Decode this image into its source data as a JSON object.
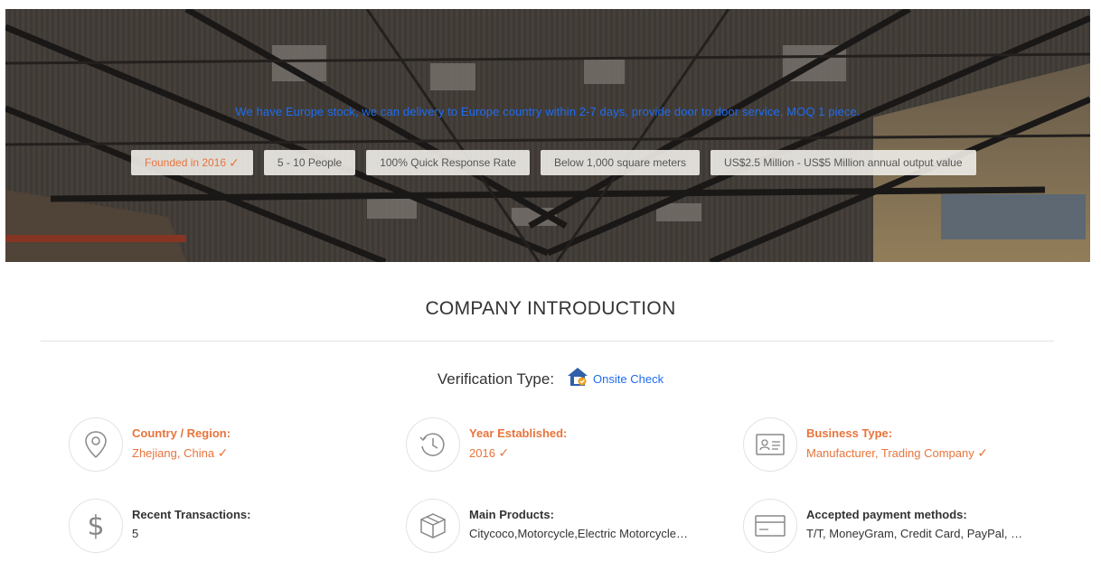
{
  "hero": {
    "tagline": "We have Europe stock, we can delivery to Europe country within 2-7 days, provide door to door service, MOQ 1 piece.",
    "badges": [
      {
        "label": "Founded in 2016",
        "verified": true
      },
      {
        "label": "5 - 10 People",
        "verified": false
      },
      {
        "label": "100% Quick Response Rate",
        "verified": false
      },
      {
        "label": "Below 1,000 square meters",
        "verified": false
      },
      {
        "label": "US$2.5 Million - US$5 Million annual output value",
        "verified": false
      }
    ]
  },
  "intro": {
    "title": "COMPANY INTRODUCTION",
    "verification_label": "Verification Type:",
    "verification_value": "Onsite Check"
  },
  "facts": [
    {
      "title": "Country / Region:",
      "value": "Zhejiang, China",
      "icon": "location-pin-icon",
      "verified": true
    },
    {
      "title": "Year Established:",
      "value": "2016",
      "icon": "history-clock-icon",
      "verified": true
    },
    {
      "title": "Business Type:",
      "value": "Manufacturer, Trading Company",
      "icon": "id-card-icon",
      "verified": true
    },
    {
      "title": "Recent Transactions:",
      "value": "5",
      "icon": "dollar-icon",
      "verified": false
    },
    {
      "title": "Main Products:",
      "value": "Citycoco,Motorcycle,Electric Motorcycle,Electric Scooter",
      "icon": "package-box-icon",
      "verified": false
    },
    {
      "title": "Accepted payment methods:",
      "value": "T/T, MoneyGram, Credit Card, PayPal, Western Union, Cash",
      "icon": "credit-card-icon",
      "verified": false
    }
  ],
  "colors": {
    "accent": "#e8743b",
    "link": "#1e6cf0",
    "text": "#333333"
  }
}
